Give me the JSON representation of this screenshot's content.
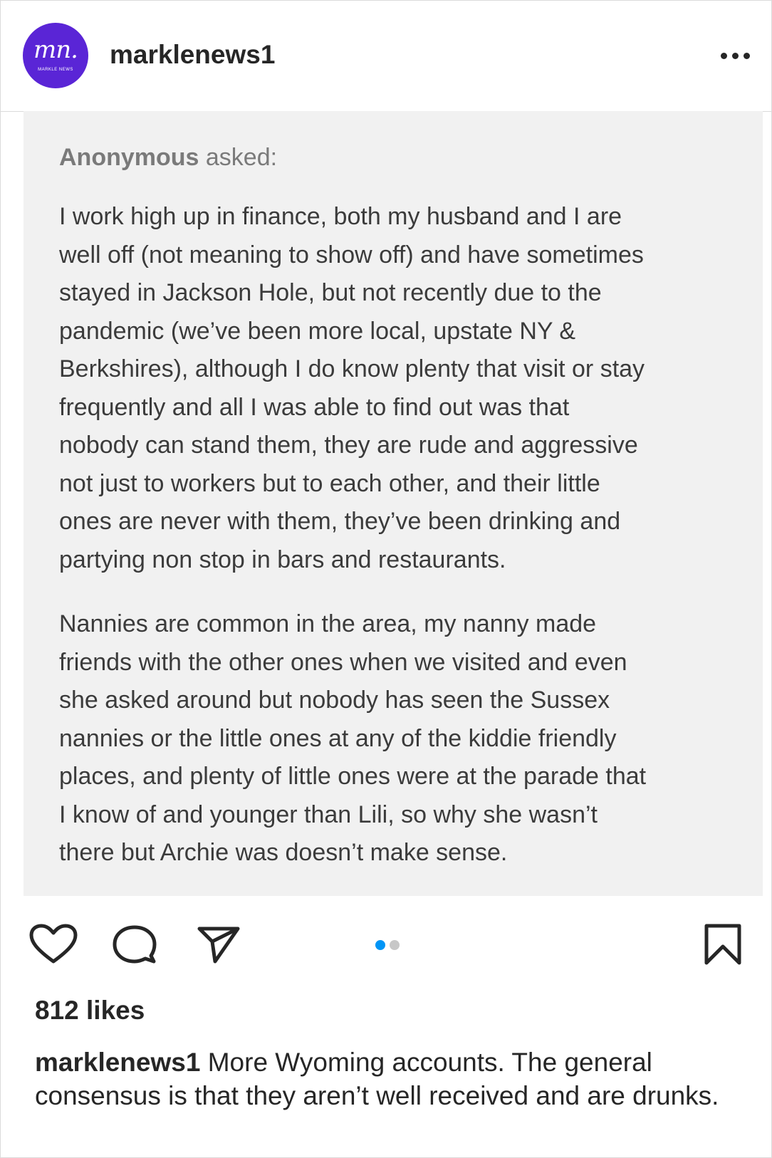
{
  "header": {
    "avatar_mark": "mn.",
    "avatar_subtext": "MARKLE NEWS",
    "username": "marklenews1",
    "more_label": "•••"
  },
  "post_image": {
    "asker_name": "Anonymous",
    "asker_suffix": " asked:",
    "paragraph_1": "I work high up in finance, both my husband and I are\nwell off (not meaning to show off) and have sometimes\nstayed in Jackson Hole, but not recently due to the\npandemic (we’ve been more local, upstate NY &\nBerkshires), although I do know plenty that visit or stay\nfrequently and all I was able to find out was that\nnobody can stand them, they are rude and aggressive\nnot just to workers but to each other, and their little\nones are never with them, they’ve been drinking and\npartying non stop in bars and restaurants.",
    "paragraph_2": "Nannies are common in the area, my nanny made\nfriends with the other ones when we visited and even\nshe asked around but nobody has seen the Sussex\nnannies or the little ones at any of the kiddie friendly\nplaces, and plenty of little ones were at the parade that\nI know of and younger than Lili, so why she wasn’t\nthere but Archie was doesn’t make sense."
  },
  "actions": {
    "icons": [
      "heart-icon",
      "comment-icon",
      "share-icon",
      "bookmark-icon"
    ],
    "carousel": {
      "total": 2,
      "active": 1
    }
  },
  "likes": "812 likes",
  "caption": {
    "username": "marklenews1",
    "text": " More Wyoming accounts. The general consensus is that they aren’t well received and are drunks."
  },
  "colors": {
    "avatar": "#5a25d6",
    "card_background": "#f1f1f1",
    "pager_active": "#0095f6",
    "pager_inactive": "#c7c7c7",
    "text_primary": "#262626",
    "text_card": "#3b3b3b"
  }
}
